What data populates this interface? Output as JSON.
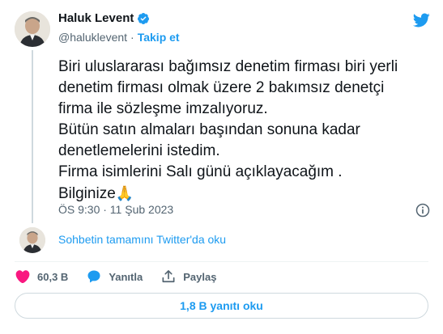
{
  "author": {
    "name": "Haluk Levent",
    "handle": "@haluklevent",
    "separator": "·",
    "follow_label": "Takip et"
  },
  "tweet": {
    "lines": [
      "Biri uluslararası bağımsız denetim firması biri yerli",
      "denetim firması olmak üzere 2 bakımsız denetçi",
      "firma ile sözleşme imzalıyoruz.",
      "Bütün satın almaları başından sonuna kadar",
      "denetlemelerini istedim.",
      "Firma isimlerini Salı günü açıklayacağım .",
      "Bilginize"
    ],
    "emoji": "🙏",
    "timestamp": "ÖS 9:30 · 11 Şub 2023"
  },
  "conversation": {
    "read_label": "Sohbetin tamamını Twitter'da oku"
  },
  "actions": {
    "like_count": "60,3 B",
    "reply_label": "Yanıtla",
    "share_label": "Paylaş"
  },
  "replies_button": {
    "label": "1,8 B yanıtı oku"
  },
  "icons": {
    "brand": "twitter-bird-icon",
    "verified": "verified-badge-icon",
    "info": "info-icon",
    "like": "heart-icon",
    "reply": "speech-bubble-icon",
    "share": "share-icon"
  },
  "colors": {
    "brand_blue": "#1d9bf0",
    "like_red": "#f91880",
    "text_primary": "#0f1419",
    "text_secondary": "#536471"
  }
}
